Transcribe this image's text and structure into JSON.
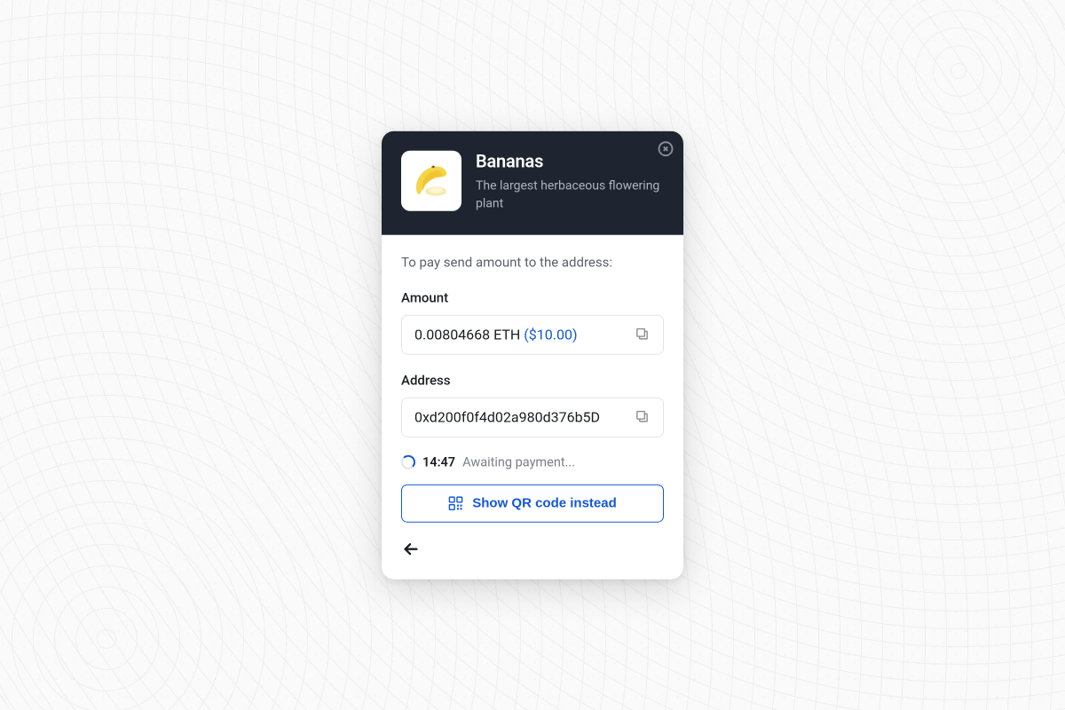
{
  "header": {
    "title": "Bananas",
    "subtitle": "The largest herbaceous flowering plant",
    "thumb_alt": "banana-icon"
  },
  "body": {
    "instruction": "To pay send amount to the address:",
    "amount_label": "Amount",
    "amount_value": "0.00804668 ETH ",
    "amount_fiat": "($10.00)",
    "address_label": "Address",
    "address_value": "0xd200f0f4d02a980d376b5D",
    "timer": "14:47",
    "status": "Awaiting payment...",
    "qr_button": "Show QR code instead"
  }
}
